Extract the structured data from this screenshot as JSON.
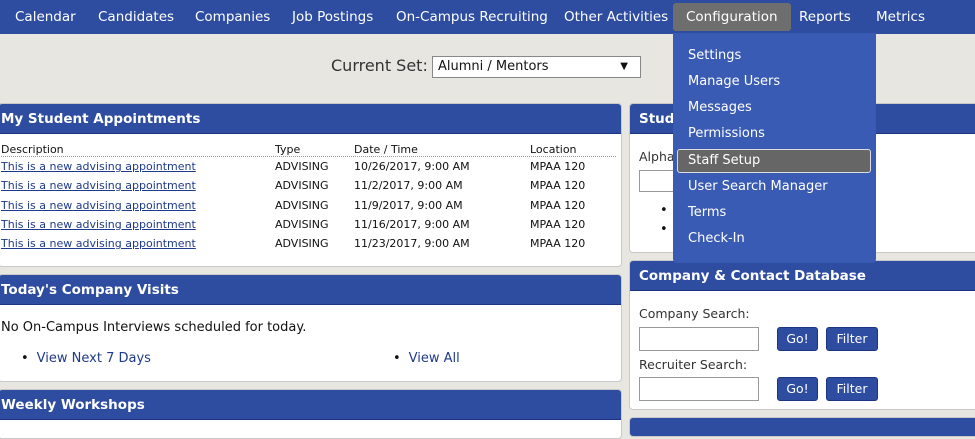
{
  "nav": {
    "items": [
      "Calendar",
      "Candidates",
      "Companies",
      "Job Postings",
      "On-Campus Recruiting",
      "Other Activities",
      "Configuration",
      "Reports",
      "Metrics"
    ]
  },
  "current_set": {
    "label": "Current Set:",
    "value": "Alumni / Mentors",
    "arrow": "▼"
  },
  "appointments": {
    "title": "My Student Appointments",
    "headers": [
      "Description",
      "Type",
      "Date / Time",
      "Location"
    ],
    "rows": [
      [
        "This is a new advising appointment",
        "ADVISING",
        "10/26/2017, 9:00 AM",
        "MPAA 120"
      ],
      [
        "This is a new advising appointment",
        "ADVISING",
        "11/2/2017, 9:00 AM",
        "MPAA 120"
      ],
      [
        "This is a new advising appointment",
        "ADVISING",
        "11/9/2017, 9:00 AM",
        "MPAA 120"
      ],
      [
        "This is a new advising appointment",
        "ADVISING",
        "11/16/2017, 9:00 AM",
        "MPAA 120"
      ],
      [
        "This is a new advising appointment",
        "ADVISING",
        "11/23/2017, 9:00 AM",
        "MPAA 120"
      ]
    ]
  },
  "visits": {
    "title": "Today's Company Visits",
    "message": "No On-Campus Interviews scheduled for today.",
    "link_next": "View Next 7 Days",
    "link_all": "View All"
  },
  "workshops": {
    "title": "Weekly Workshops"
  },
  "student_panel": {
    "title": "Stude",
    "alpha_label": "Alpha"
  },
  "config_menu": {
    "items": [
      "Settings",
      "Manage Users",
      "Messages",
      "Permissions",
      "Staff Setup",
      "User Search Manager",
      "Terms",
      "Check-In"
    ]
  },
  "company_db": {
    "title": "Company & Contact Database",
    "company_label": "Company Search:",
    "recruiter_label": "Recruiter Search:",
    "go_label": "Go!",
    "filter_label": "Filter"
  }
}
